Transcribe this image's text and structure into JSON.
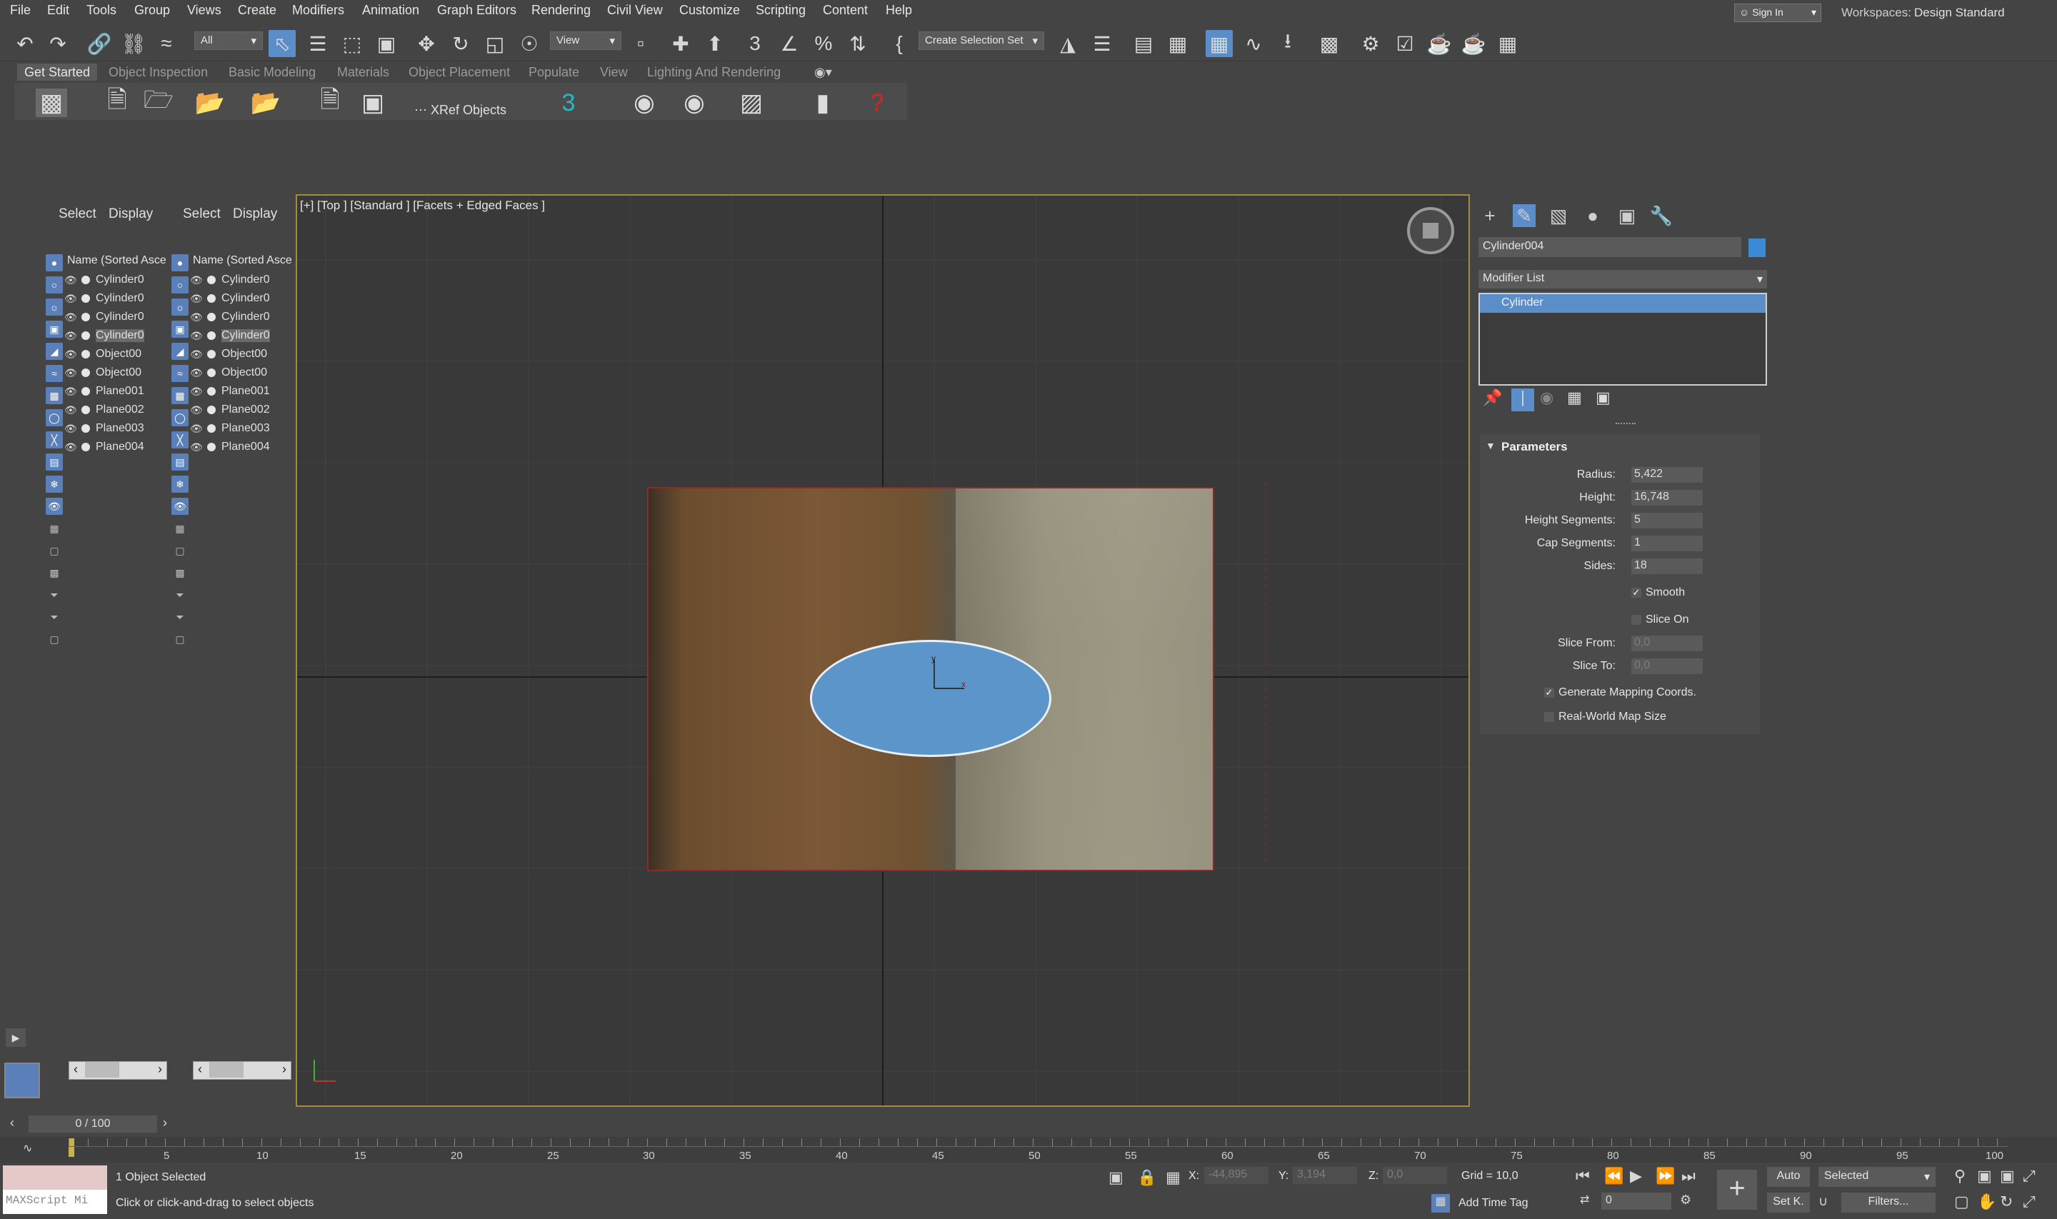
{
  "menu": [
    "File",
    "Edit",
    "Tools",
    "Group",
    "Views",
    "Create",
    "Modifiers",
    "Animation",
    "Graph Editors",
    "Rendering",
    "Civil View",
    "Customize",
    "Scripting",
    "Content",
    "Help"
  ],
  "sign_in": "Sign In",
  "workspaces_label": "Workspaces:",
  "workspace_value": "Design Standard",
  "toolbar": {
    "filter_select": "All",
    "ref_coord_select": "View",
    "selection_set": "Create Selection Set"
  },
  "ribbon_tabs": [
    "Get Started",
    "Object Inspection",
    "Basic Modeling",
    "Materials",
    "Object Placement",
    "Populate",
    "View",
    "Lighting And Rendering"
  ],
  "ribbon": {
    "xref_label": "XRef Objects"
  },
  "explorers": [
    {
      "tabs": [
        "Select",
        "Display"
      ],
      "column_header": "Name (Sorted Asce",
      "rows": [
        "Cylinder0",
        "Cylinder0",
        "Cylinder0",
        "Cylinder0",
        "Object00",
        "Object00",
        "Plane001",
        "Plane002",
        "Plane003",
        "Plane004"
      ],
      "selected_index": 3
    },
    {
      "tabs": [
        "Select",
        "Display"
      ],
      "column_header": "Name (Sorted Asce",
      "rows": [
        "Cylinder0",
        "Cylinder0",
        "Cylinder0",
        "Cylinder0",
        "Object00",
        "Object00",
        "Plane001",
        "Plane002",
        "Plane003",
        "Plane004"
      ],
      "selected_index": 3
    }
  ],
  "viewport": {
    "label": "[+] [Top ] [Standard ] [Facets + Edged Faces ]"
  },
  "command_panel": {
    "object_name": "Cylinder004",
    "object_color": "#3c89d6",
    "modifier_list": "Modifier List",
    "stack": [
      "Cylinder"
    ],
    "rollout_title": "Parameters",
    "params": [
      {
        "label": "Radius:",
        "value": "5,422",
        "enabled": true
      },
      {
        "label": "Height:",
        "value": "16,748",
        "enabled": true
      },
      {
        "label": "Height Segments:",
        "value": "5",
        "enabled": true
      },
      {
        "label": "Cap Segments:",
        "value": "1",
        "enabled": true
      },
      {
        "label": "Sides:",
        "value": "18",
        "enabled": true
      }
    ],
    "smooth": {
      "label": "Smooth",
      "checked": true
    },
    "slice_on": {
      "label": "Slice On",
      "checked": false
    },
    "slice_params": [
      {
        "label": "Slice From:",
        "value": "0,0",
        "enabled": false
      },
      {
        "label": "Slice To:",
        "value": "0,0",
        "enabled": false
      }
    ],
    "gen_mapping": {
      "label": "Generate Mapping Coords.",
      "checked": true
    },
    "real_world": {
      "label": "Real-World Map Size",
      "checked": false
    }
  },
  "time": {
    "slider_label": "0 / 100",
    "ticks": [
      "5",
      "10",
      "15",
      "20",
      "25",
      "30",
      "35",
      "40",
      "45",
      "50",
      "55",
      "60",
      "65",
      "70",
      "75",
      "80",
      "85",
      "90",
      "95",
      "100"
    ]
  },
  "status": {
    "maxscript": "MAXScript Mi",
    "selection": "1 Object Selected",
    "prompt": "Click or click-and-drag to select objects",
    "x_label": "X:",
    "x_value": "-44,895",
    "y_label": "Y:",
    "y_value": "3,194",
    "z_label": "Z:",
    "z_value": "0,0",
    "grid": "Grid = 10,0",
    "add_time_tag": "Add Time Tag",
    "auto": "Auto",
    "selected": "Selected",
    "set_key": "Set K.",
    "filters": "Filters...",
    "frame_value": "0"
  }
}
